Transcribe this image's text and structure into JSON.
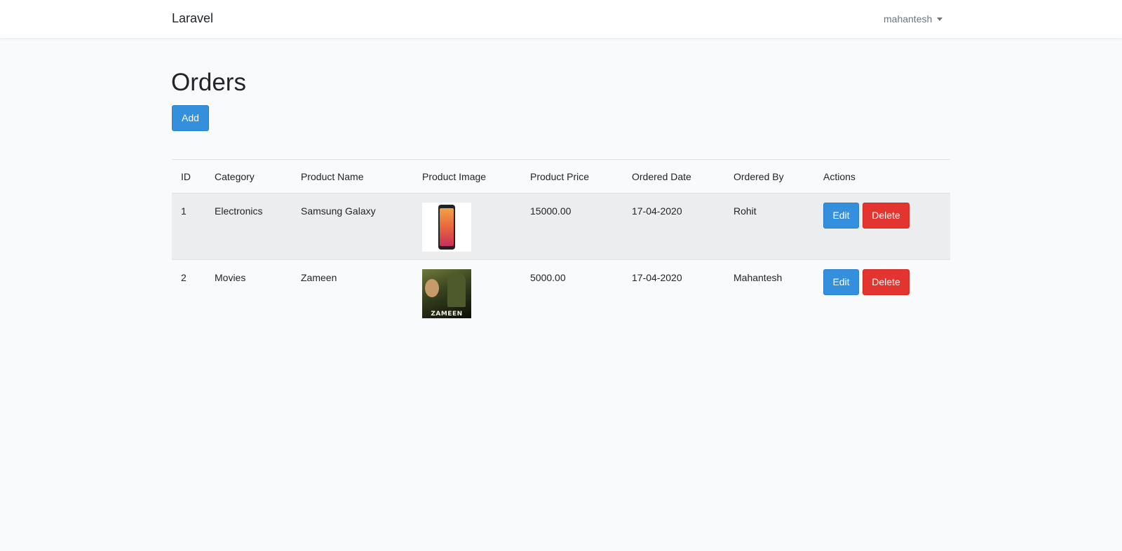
{
  "navbar": {
    "brand": "Laravel",
    "user": "mahantesh"
  },
  "page": {
    "title": "Orders",
    "add_label": "Add"
  },
  "colors": {
    "primary": "#3490dc",
    "danger": "#e3342f",
    "background": "#f8fafc"
  },
  "table": {
    "headers": [
      "ID",
      "Category",
      "Product Name",
      "Product Image",
      "Product Price",
      "Ordered Date",
      "Ordered By",
      "Actions"
    ],
    "rows": [
      {
        "id": "1",
        "category": "Electronics",
        "product_name": "Samsung Galaxy",
        "image_icon": "smartphone-image",
        "price": "15000.00",
        "date": "17-04-2020",
        "ordered_by": "Rohit",
        "edit_label": "Edit",
        "delete_label": "Delete"
      },
      {
        "id": "2",
        "category": "Movies",
        "product_name": "Zameen",
        "image_icon": "movie-poster-image",
        "image_caption": "ZAMEEN",
        "price": "5000.00",
        "date": "17-04-2020",
        "ordered_by": "Mahantesh",
        "edit_label": "Edit",
        "delete_label": "Delete"
      }
    ]
  }
}
